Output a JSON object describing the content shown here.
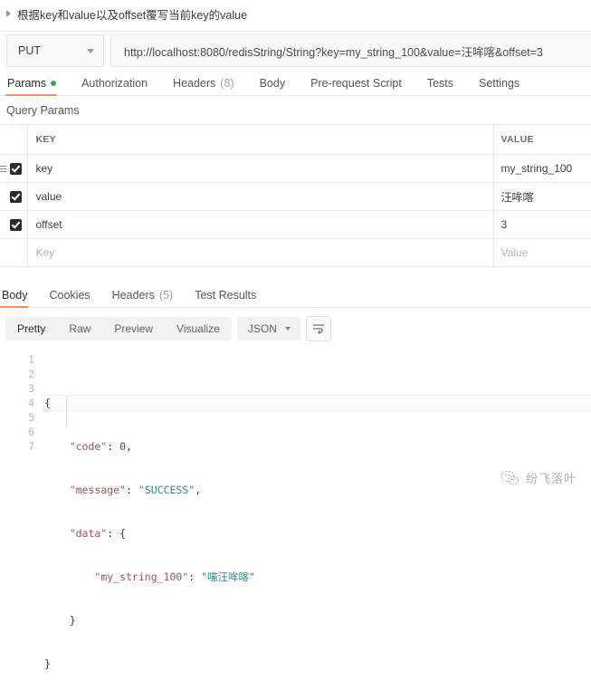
{
  "request_title": {
    "collapse_icon": "caret-right-icon",
    "text": "根据key和value以及offset覆写当前key的value"
  },
  "url_bar": {
    "method": "PUT",
    "method_caret": "chevron-down-icon",
    "url": "http://localhost:8080/redisString/String?key=my_string_100&value=汪哞喀&offset=3"
  },
  "request_tabs": [
    {
      "label": "Params",
      "badge": "",
      "has_dot": true,
      "active": true
    },
    {
      "label": "Authorization",
      "badge": "",
      "has_dot": false,
      "active": false
    },
    {
      "label": "Headers",
      "badge": "(8)",
      "has_dot": false,
      "active": false
    },
    {
      "label": "Body",
      "badge": "",
      "has_dot": false,
      "active": false
    },
    {
      "label": "Pre-request Script",
      "badge": "",
      "has_dot": false,
      "active": false
    },
    {
      "label": "Tests",
      "badge": "",
      "has_dot": false,
      "active": false
    },
    {
      "label": "Settings",
      "badge": "",
      "has_dot": false,
      "active": false
    }
  ],
  "query_params": {
    "section_label": "Query Params",
    "columns": {
      "key": "KEY",
      "value": "VALUE"
    },
    "rows": [
      {
        "checked": true,
        "has_drag_handle": true,
        "key": "key",
        "value": "my_string_100",
        "placeholder": false
      },
      {
        "checked": true,
        "has_drag_handle": false,
        "key": "value",
        "value": "汪哞喀",
        "placeholder": false
      },
      {
        "checked": true,
        "has_drag_handle": false,
        "key": "offset",
        "value": "3",
        "placeholder": false
      },
      {
        "checked": false,
        "has_drag_handle": false,
        "key": "Key",
        "value": "Value",
        "placeholder": true
      }
    ]
  },
  "response_tabs": [
    {
      "label": "Body",
      "badge": "",
      "active": true
    },
    {
      "label": "Cookies",
      "badge": "",
      "active": false
    },
    {
      "label": "Headers",
      "badge": "(5)",
      "active": false
    },
    {
      "label": "Test Results",
      "badge": "",
      "active": false
    }
  ],
  "format_bar": {
    "views": [
      {
        "label": "Pretty",
        "active": true
      },
      {
        "label": "Raw",
        "active": false
      },
      {
        "label": "Preview",
        "active": false
      },
      {
        "label": "Visualize",
        "active": false
      }
    ],
    "language": "JSON",
    "language_caret": "chevron-down-icon",
    "wrap_icon": "word-wrap-icon"
  },
  "response_body": {
    "line_numbers": [
      "1",
      "2",
      "3",
      "4",
      "5",
      "6",
      "7"
    ],
    "json": {
      "code": 0,
      "message": "SUCCESS",
      "data": {
        "my_string_100": "喵汪哞喀"
      }
    },
    "lines": [
      "{",
      "    \"code\": 0,",
      "    \"message\": \"SUCCESS\",",
      "    \"data\": {",
      "        \"my_string_100\": \"喵汪哞喀\"",
      "    }",
      "}"
    ],
    "tokens": {
      "l2_key": "\"code\"",
      "l2_sep": ": ",
      "l2_val": "0",
      "l2_tail": ",",
      "l3_key": "\"message\"",
      "l3_sep": ": ",
      "l3_val": "\"SUCCESS\"",
      "l3_tail": ",",
      "l4_key": "\"data\"",
      "l4_sep": ": ",
      "l4_val": "{",
      "l5_key": "\"my_string_100\"",
      "l5_sep": ": ",
      "l5_val": "\"喵汪哞喀\"",
      "l6_val": "}",
      "l1_val": "{",
      "l7_val": "}"
    }
  },
  "watermark": {
    "icon": "wechat-icon",
    "text": "纷飞落叶"
  },
  "colors": {
    "accent_underline": "#ef8f5b",
    "status_dot_green": "#3cab4e",
    "checkbox_dark": "#2b2b2b",
    "json_string": "#2b8a8f",
    "json_key": "#a6505a",
    "json_number": "#4a4a8a"
  }
}
